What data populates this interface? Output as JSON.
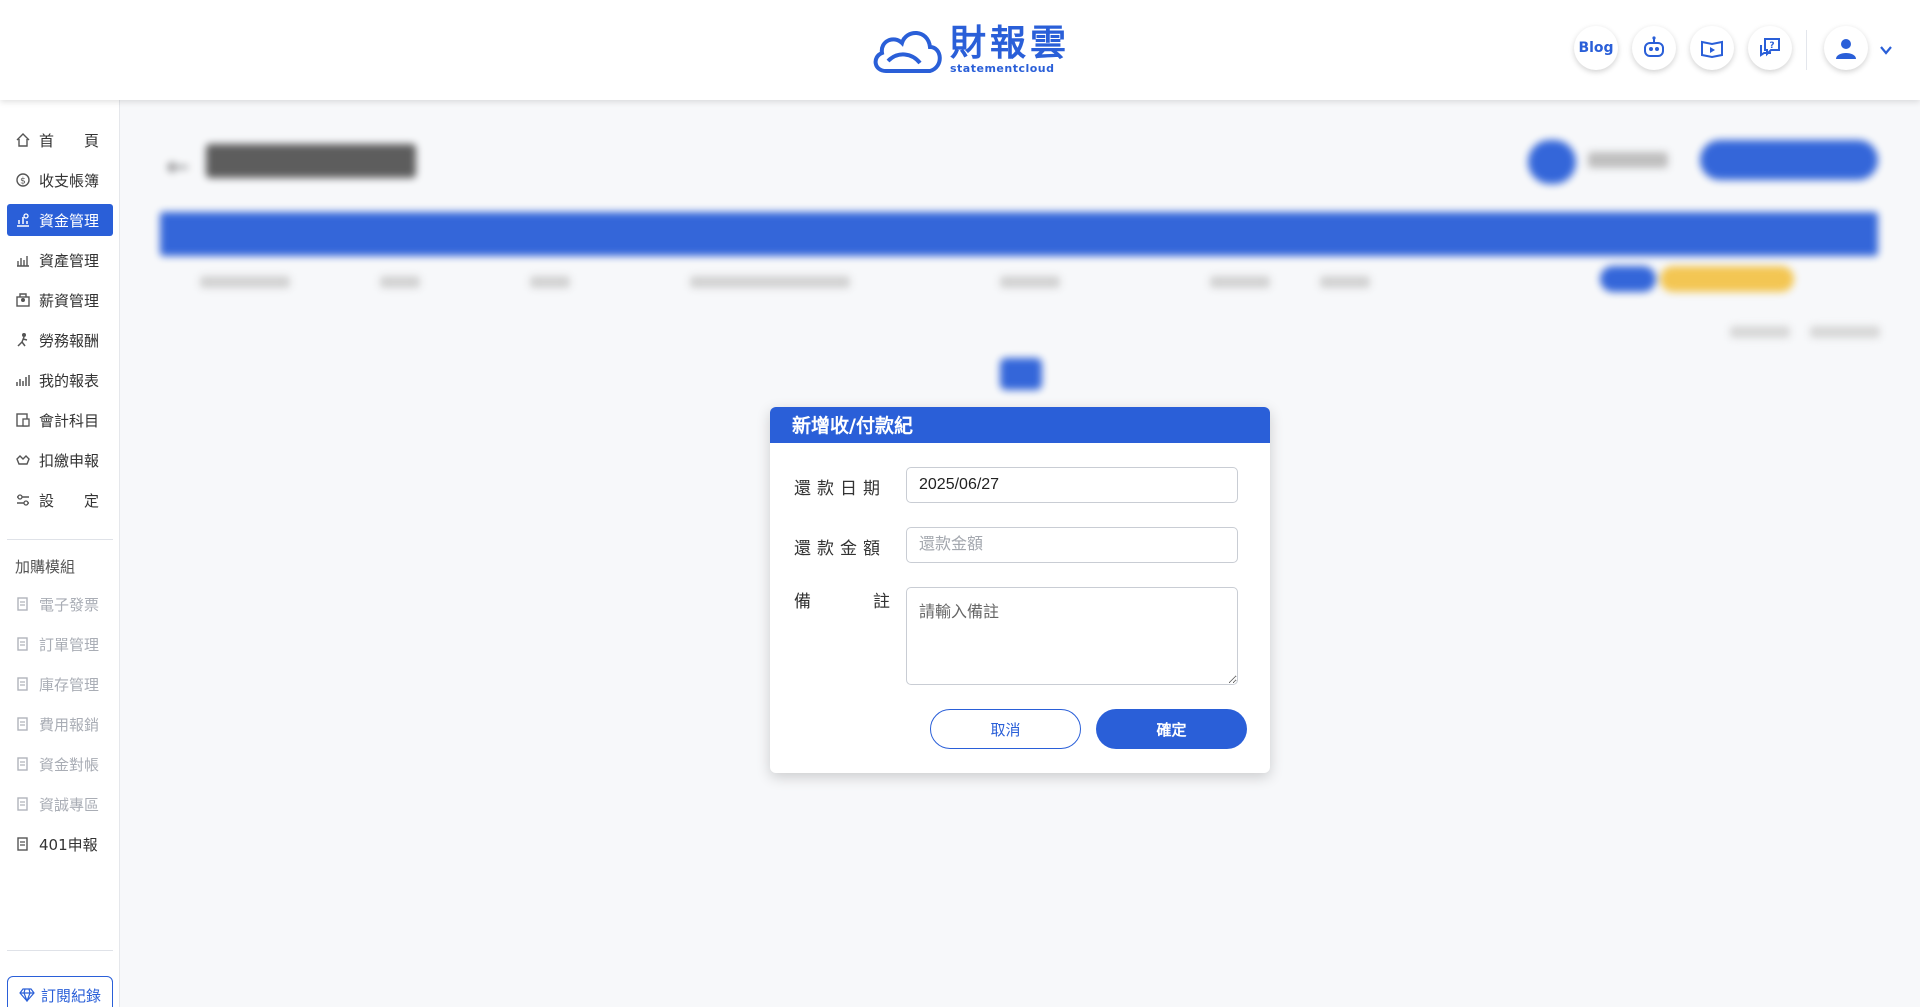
{
  "header": {
    "logo_cn": "財報雲",
    "logo_en": "statementcloud",
    "blog_label": "Blog",
    "icons": [
      "robot-icon",
      "video-book-icon",
      "help-chat-icon",
      "user-avatar-icon",
      "chevron-down-icon"
    ]
  },
  "sidebar": {
    "items": [
      {
        "label": "首　　頁",
        "icon": "home-icon"
      },
      {
        "label": "收支帳簿",
        "icon": "coin-icon"
      },
      {
        "label": "資金管理",
        "icon": "fund-icon",
        "active": true
      },
      {
        "label": "資產管理",
        "icon": "asset-icon"
      },
      {
        "label": "薪資管理",
        "icon": "salary-icon"
      },
      {
        "label": "勞務報酬",
        "icon": "labor-icon"
      },
      {
        "label": "我的報表",
        "icon": "report-icon"
      },
      {
        "label": "會計科目",
        "icon": "account-icon"
      },
      {
        "label": "扣繳申報",
        "icon": "tax-icon"
      },
      {
        "label": "設　　定",
        "icon": "settings-icon"
      }
    ],
    "addon_title": "加購模組",
    "addons": [
      {
        "label": "電子發票",
        "disabled": true
      },
      {
        "label": "訂單管理",
        "disabled": true
      },
      {
        "label": "庫存管理",
        "disabled": true
      },
      {
        "label": "費用報銷",
        "disabled": true
      },
      {
        "label": "資金對帳",
        "disabled": true
      },
      {
        "label": "資誠專區",
        "disabled": true
      },
      {
        "label": "401申報",
        "disabled": false
      }
    ],
    "subscription_label": "訂閱紀錄"
  },
  "modal": {
    "title": "新增收/付款紀",
    "date_label": "還款日期",
    "date_value": "2025/06/27",
    "amount_label": "還款金額",
    "amount_placeholder": "還款金額",
    "note_label": "備　註",
    "note_placeholder": "請輸入備註",
    "cancel_label": "取消",
    "confirm_label": "確定"
  },
  "colors": {
    "primary": "#2a5fd8",
    "tag_yellow": "#f3c44b"
  }
}
